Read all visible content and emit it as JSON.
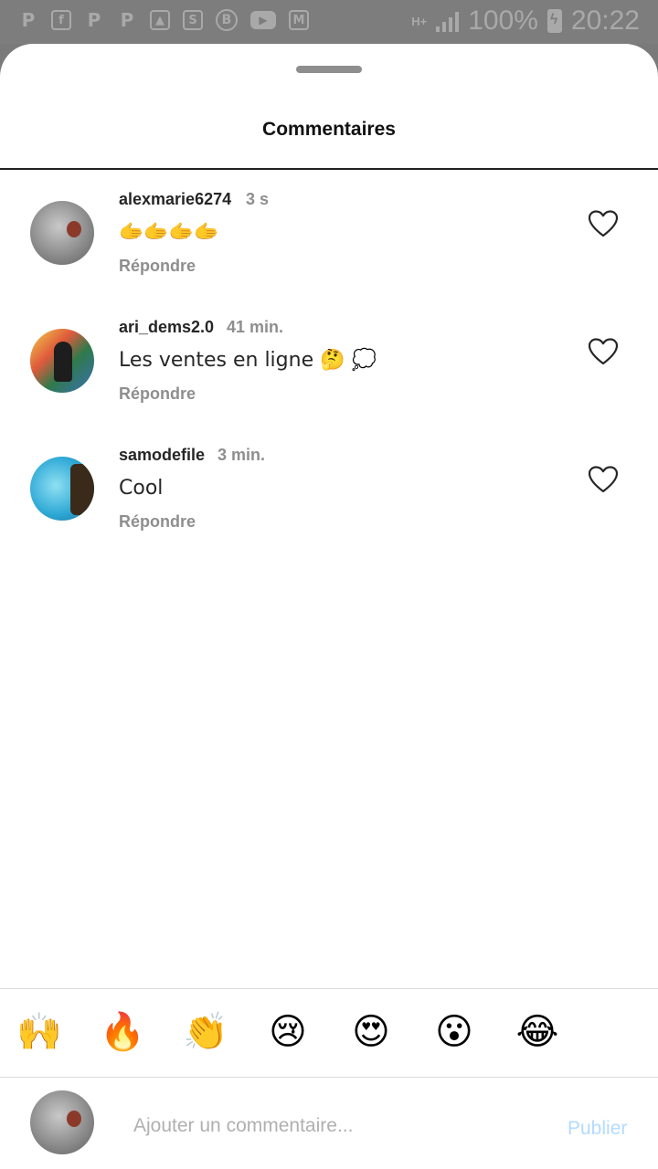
{
  "status_bar": {
    "network": "H+",
    "battery": "100%",
    "time": "20:22",
    "notification_icons": [
      "p-app-icon",
      "facebook-icon",
      "p-app-icon",
      "p-app-icon",
      "gallery-icon",
      "skype-icon",
      "b-app-icon",
      "youtube-icon",
      "gmail-icon"
    ]
  },
  "sheet": {
    "title": "Commentaires"
  },
  "comments": [
    {
      "username": "alexmarie6274",
      "time": "3 s",
      "text": "🫱🫱🫱🫱",
      "reply": "Répondre"
    },
    {
      "username": "ari_dems2.0",
      "time": "41 min.",
      "text": "Les ventes en ligne 🤔 💭",
      "reply": "Répondre"
    },
    {
      "username": "samodefile",
      "time": "3 min.",
      "text": "Cool",
      "reply": "Répondre"
    }
  ],
  "emoji_bar": [
    "🙌",
    "🔥",
    "👏",
    "😢",
    "😍",
    "😮",
    "😂"
  ],
  "composer": {
    "placeholder": "Ajouter un commentaire...",
    "publish_label": "Publier"
  },
  "colors": {
    "accent_disabled": "#b3dbff",
    "muted_text": "#8e8e8e",
    "primary_text": "#262626"
  }
}
